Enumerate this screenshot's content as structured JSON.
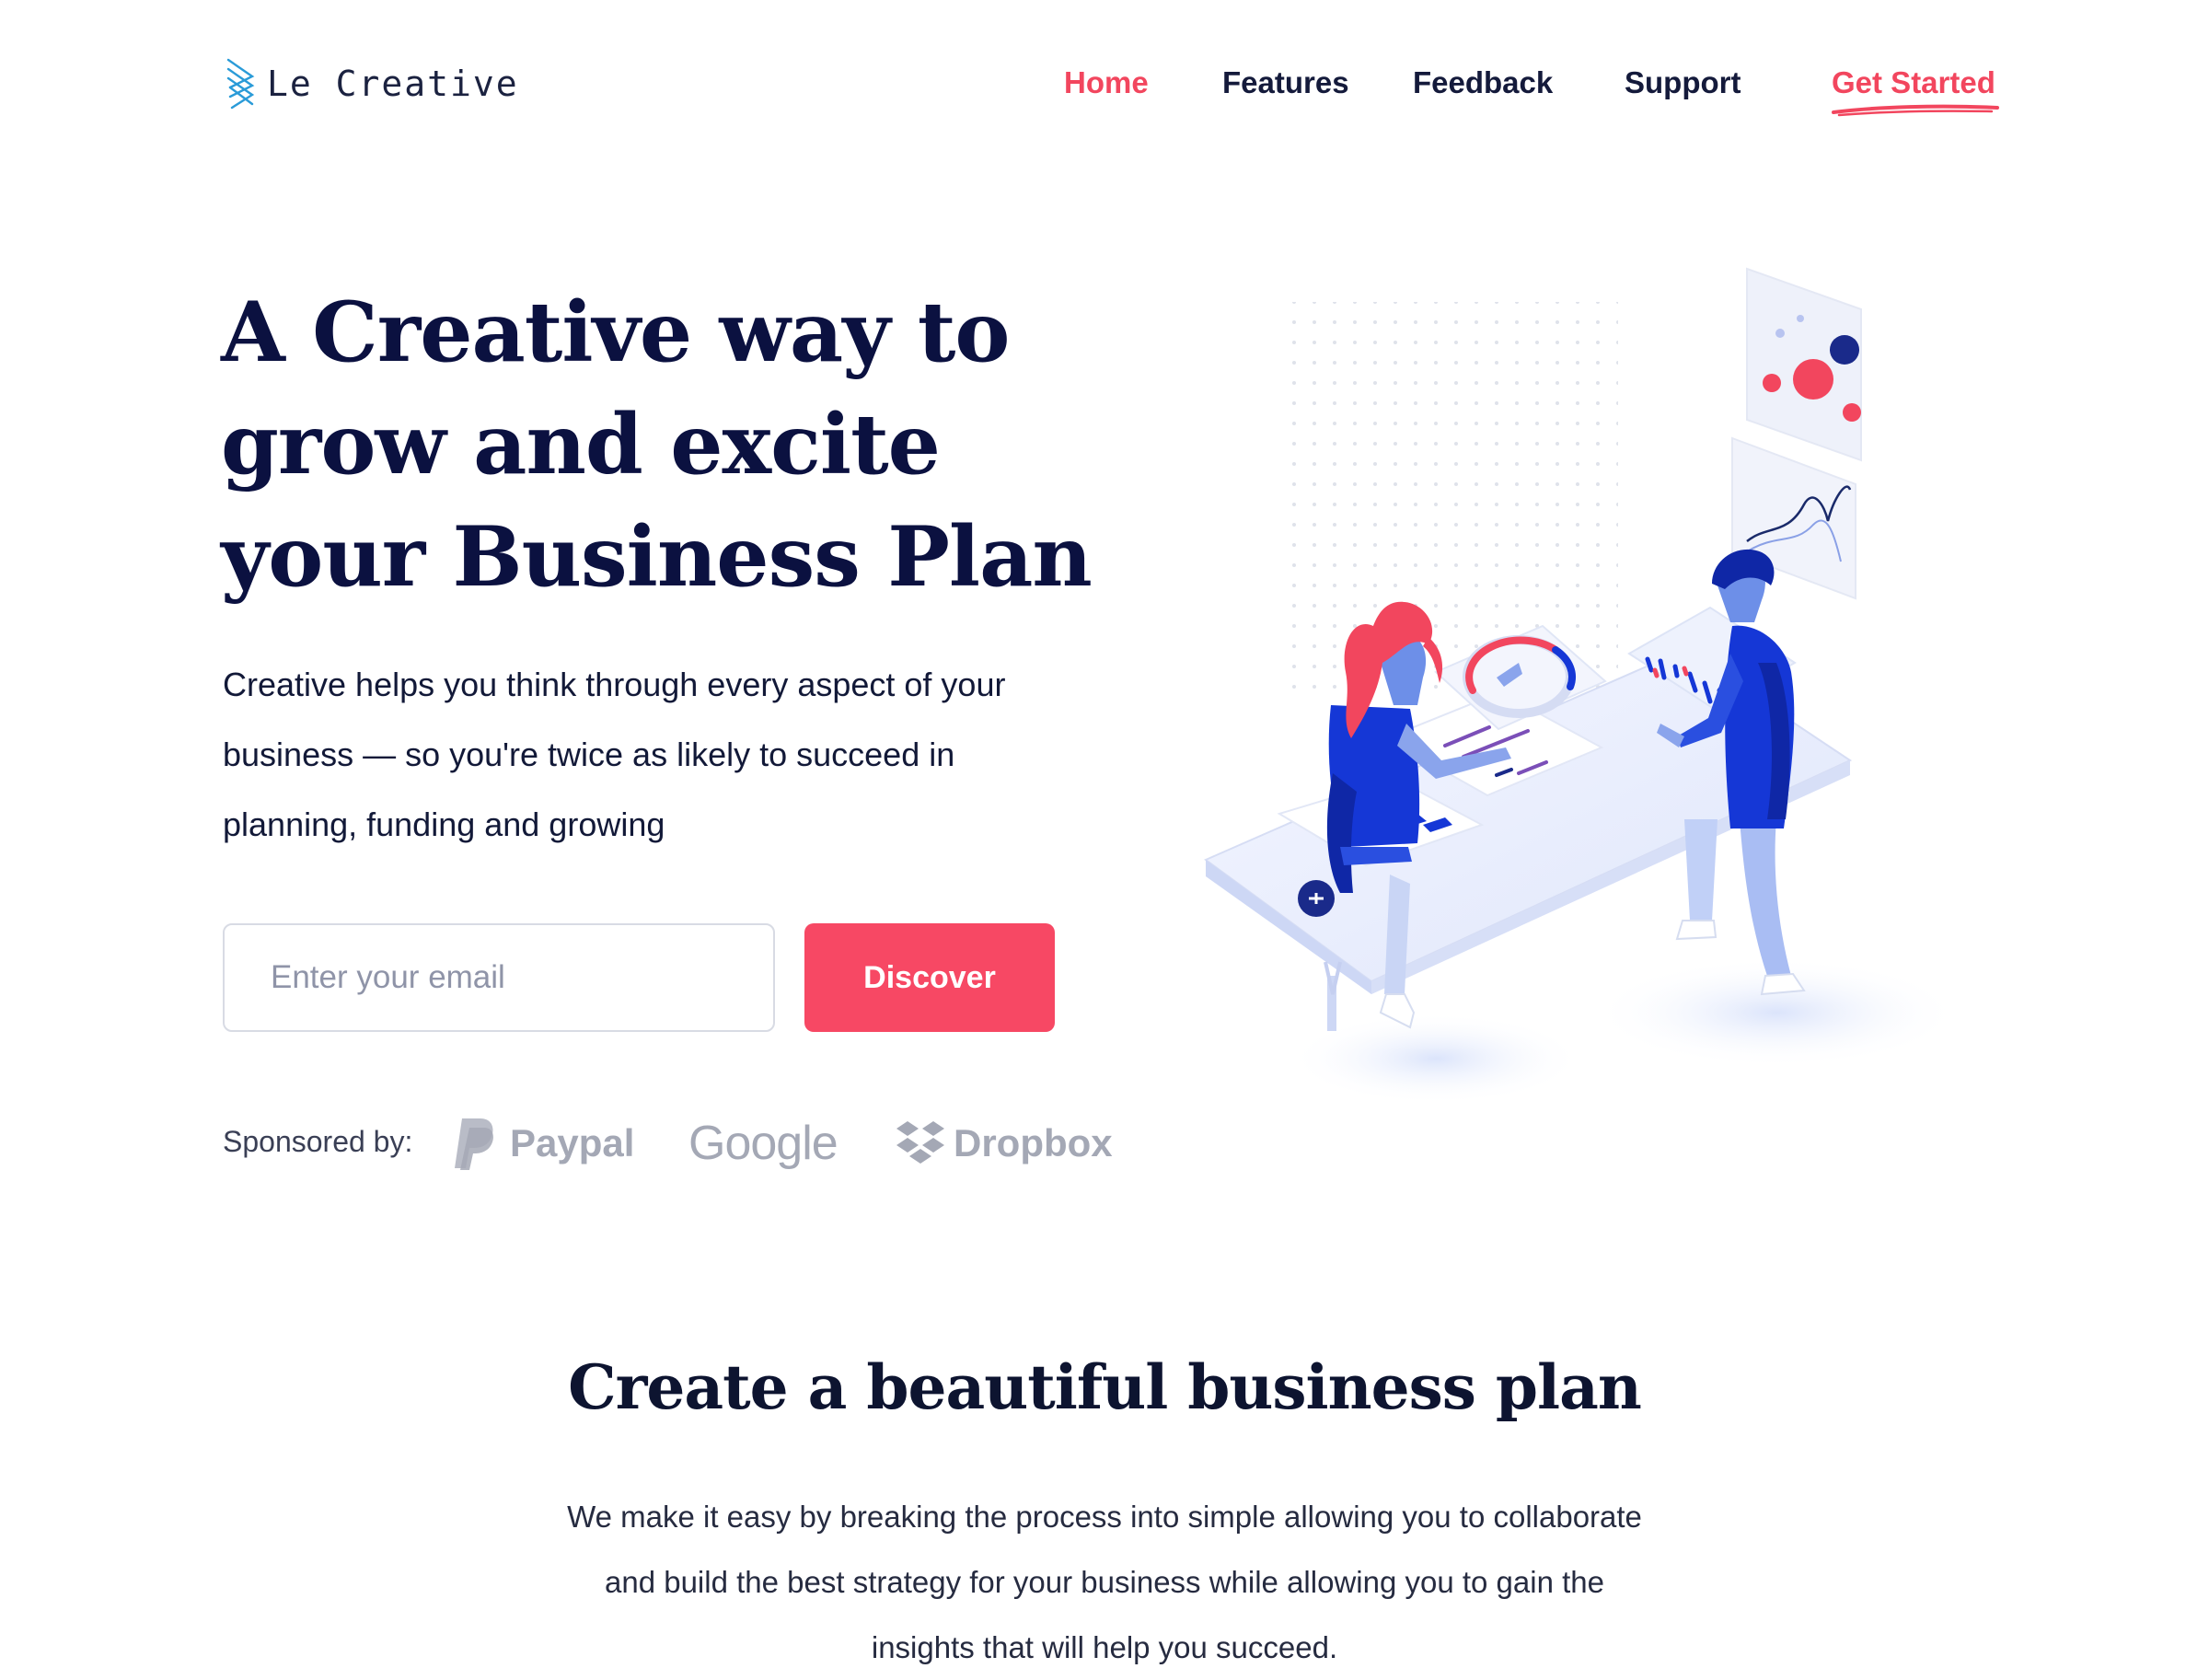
{
  "brand": {
    "name": "Le Creative",
    "logo_icon": "stacked-lines-logo-icon"
  },
  "nav": {
    "items": [
      {
        "label": "Home",
        "active": true
      },
      {
        "label": "Features",
        "active": false
      },
      {
        "label": "Feedback",
        "active": false
      },
      {
        "label": "Support",
        "active": false
      }
    ],
    "cta_label": "Get Started"
  },
  "hero": {
    "title": "A Creative way to grow and excite your Business Plan",
    "subtitle": "Creative helps you think through every aspect of your business — so you're twice as likely to succeed in planning, funding and growing",
    "email_placeholder": "Enter your email",
    "email_value": "",
    "button_label": "Discover",
    "sponsored_label": "Sponsored by:",
    "sponsors": [
      {
        "name": "Paypal",
        "icon": "paypal-icon"
      },
      {
        "name": "Google",
        "icon": ""
      },
      {
        "name": "Dropbox",
        "icon": "dropbox-icon"
      }
    ],
    "illustration": "isometric-business-team-illustration"
  },
  "section": {
    "title": "Create a beautiful business plan",
    "text": "We make it easy by breaking the process into simple allowing you to collaborate and build the best strategy for your business while allowing you to gain the insights that will help you succeed."
  },
  "colors": {
    "accent": "#f74864",
    "heading": "#0b1140",
    "text": "#121938",
    "muted_logo": "#a4a8b5",
    "illustration_blue": "#1537d6"
  }
}
